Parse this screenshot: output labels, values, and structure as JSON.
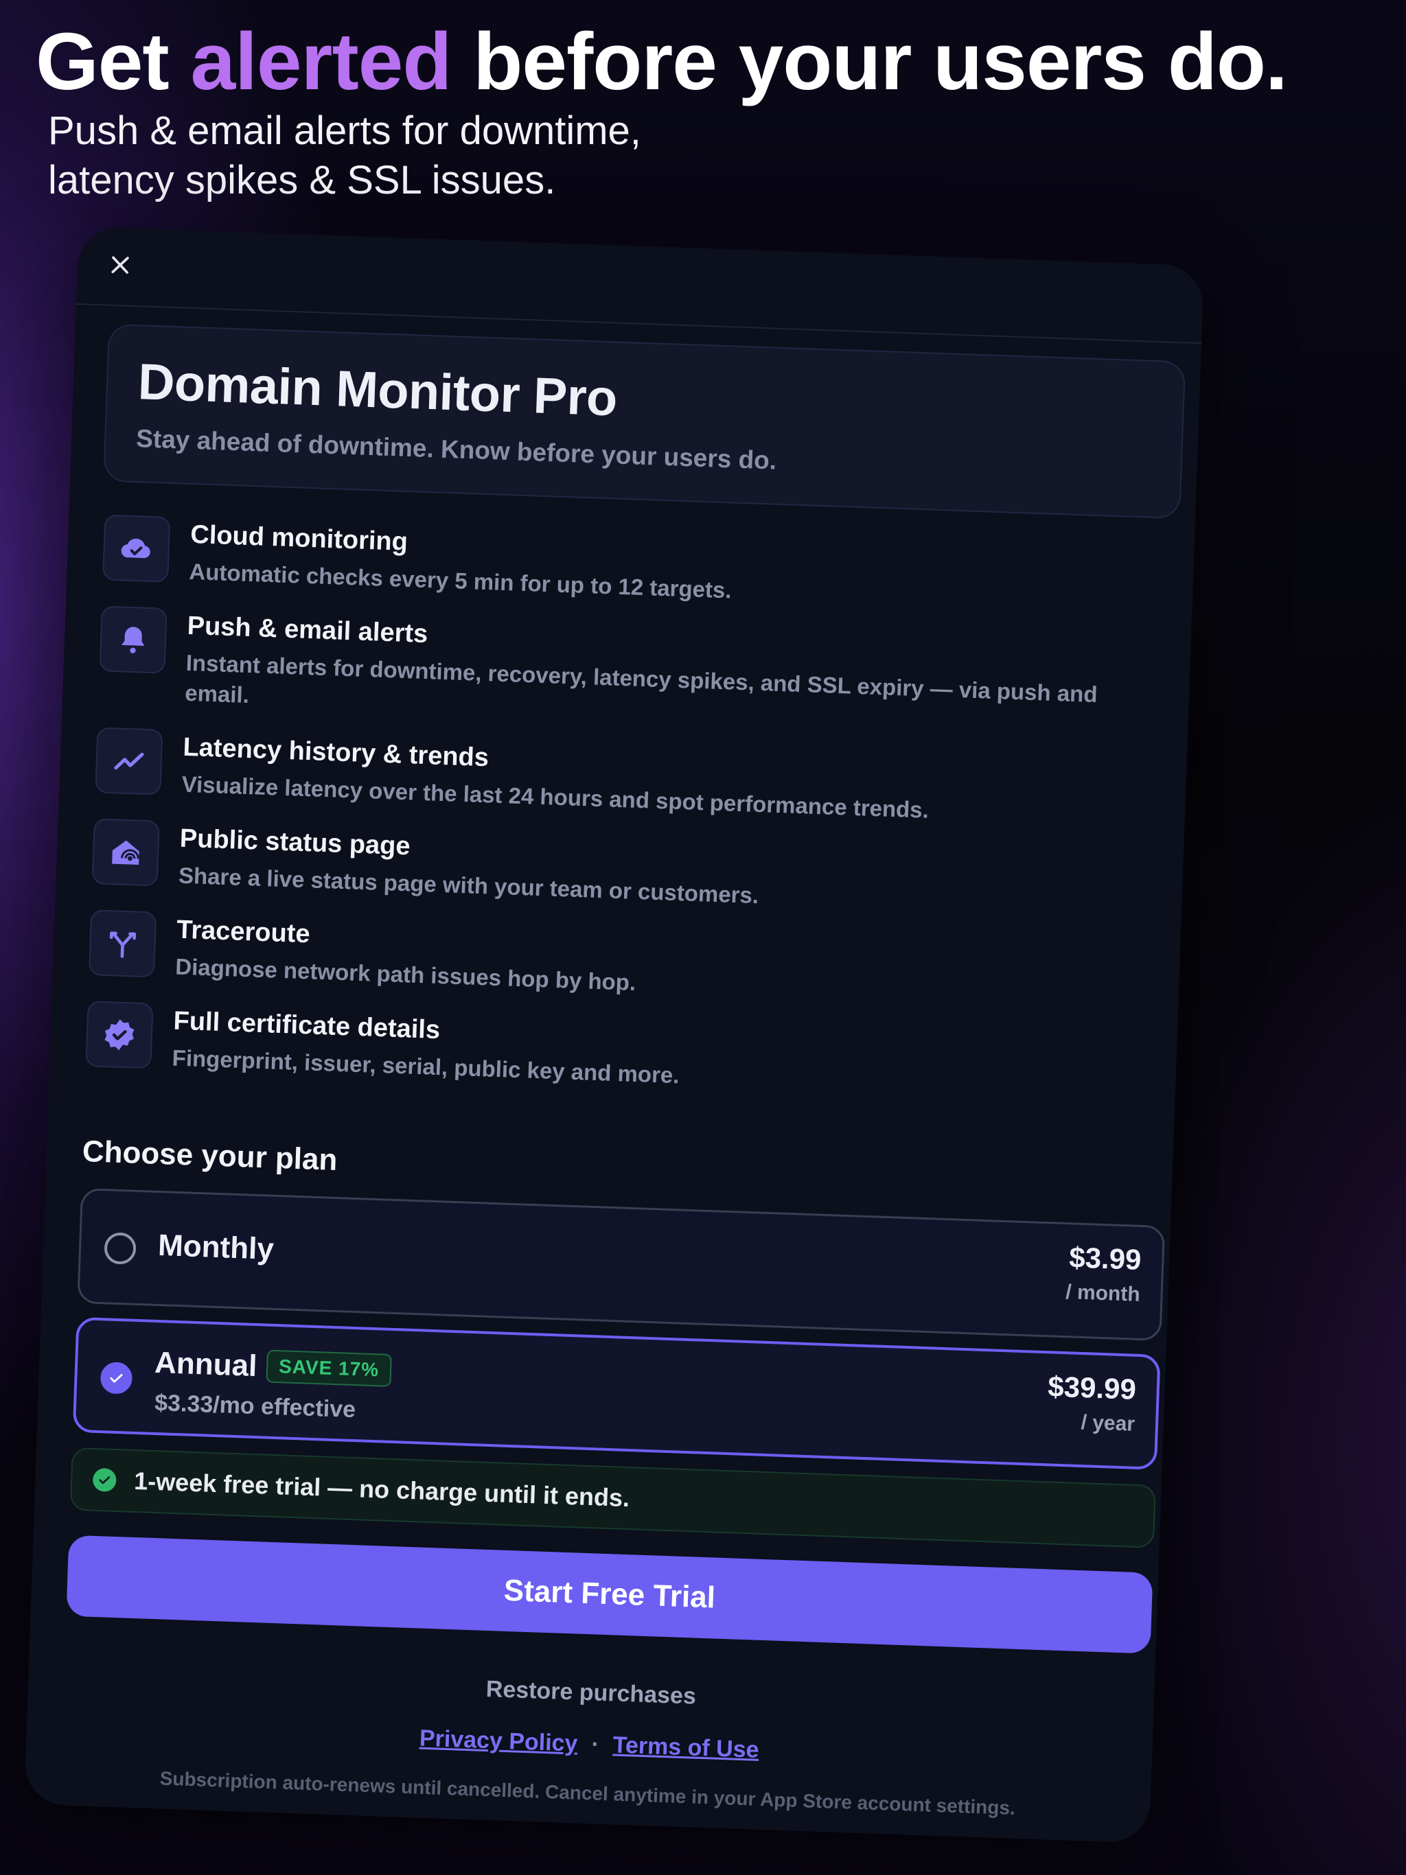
{
  "header": {
    "headline_before": "Get ",
    "headline_accent": "alerted",
    "headline_after": " before your users do.",
    "subhead_line1": "Push & email alerts for downtime,",
    "subhead_line2": "latency spikes & SSL issues."
  },
  "paywall": {
    "title": "Domain Monitor Pro",
    "subtitle": "Stay ahead of downtime. Know before your users do.",
    "features": [
      {
        "icon": "cloud-check-icon",
        "title": "Cloud monitoring",
        "desc": "Automatic checks every 5 min for up to 12 targets."
      },
      {
        "icon": "bell-icon",
        "title": "Push & email alerts",
        "desc": "Instant alerts for downtime, recovery, latency spikes, and SSL expiry — via push and email."
      },
      {
        "icon": "trend-chart-icon",
        "title": "Latency history & trends",
        "desc": "Visualize latency over the last 24 hours and spot performance trends."
      },
      {
        "icon": "broadcast-house-icon",
        "title": "Public status page",
        "desc": "Share a live status page with your team or customers."
      },
      {
        "icon": "split-path-icon",
        "title": "Traceroute",
        "desc": "Diagnose network path issues hop by hop."
      },
      {
        "icon": "verified-badge-icon",
        "title": "Full certificate details",
        "desc": "Fingerprint, issuer, serial, public key and more."
      }
    ],
    "plan_heading": "Choose your plan",
    "plans": {
      "monthly": {
        "name": "Monthly",
        "price": "$3.99",
        "period": "/ month",
        "selected": false
      },
      "annual": {
        "name": "Annual",
        "badge": "SAVE 17%",
        "effective": "$3.33/mo effective",
        "price": "$39.99",
        "period": "/ year",
        "selected": true
      }
    },
    "trial_note": "1-week free trial — no charge until it ends.",
    "cta_label": "Start Free Trial",
    "restore_label": "Restore purchases",
    "privacy_label": "Privacy Policy",
    "separator": "·",
    "terms_label": "Terms of Use",
    "fineprint": "Subscription auto-renews until cancelled. Cancel anytime in your App Store account settings."
  },
  "colors": {
    "accent": "#6c5ff2",
    "headline_accent": "#b871f0",
    "success": "#2fb86a",
    "card_bg": "#0c0f1c"
  }
}
